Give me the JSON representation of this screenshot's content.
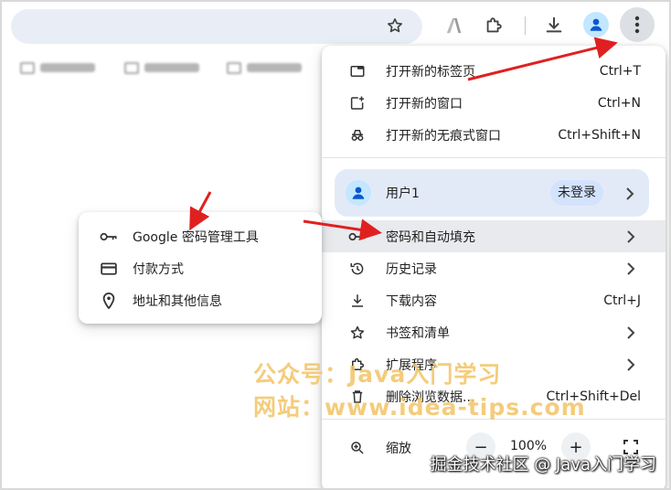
{
  "toolbar": {
    "icons": [
      "star-icon",
      "translate-icon",
      "extension-icon",
      "download-icon",
      "profile-icon",
      "more-vert-icon"
    ]
  },
  "menu": {
    "new_tab": {
      "label": "打开新的标签页",
      "shortcut": "Ctrl+T"
    },
    "new_window": {
      "label": "打开新的窗口",
      "shortcut": "Ctrl+N"
    },
    "incognito": {
      "label": "打开新的无痕式窗口",
      "shortcut": "Ctrl+Shift+N"
    },
    "profile": {
      "name": "用户1",
      "status": "未登录"
    },
    "passwords": {
      "label": "密码和自动填充"
    },
    "history": {
      "label": "历史记录"
    },
    "downloads": {
      "label": "下载内容",
      "shortcut": "Ctrl+J"
    },
    "bookmarks": {
      "label": "书签和清单"
    },
    "extensions": {
      "label": "扩展程序"
    },
    "clear_data": {
      "label": "删除浏览数据...",
      "shortcut": "Ctrl+Shift+Del"
    },
    "zoom": {
      "label": "缩放",
      "minus": "−",
      "value": "100%",
      "plus": "+"
    }
  },
  "submenu": {
    "password_manager": "Google 密码管理工具",
    "payment": "付款方式",
    "addresses": "地址和其他信息"
  },
  "watermark": {
    "line1": "公众号：Java入门学习",
    "line2": "网站：www.idea-tips.com",
    "credit": "掘金技术社区 @ Java入门学习"
  },
  "colors": {
    "accent": "#0b57d0",
    "highlight": "#e8eaed",
    "arrow": "#e02020",
    "watermark": "#f3c66b"
  }
}
